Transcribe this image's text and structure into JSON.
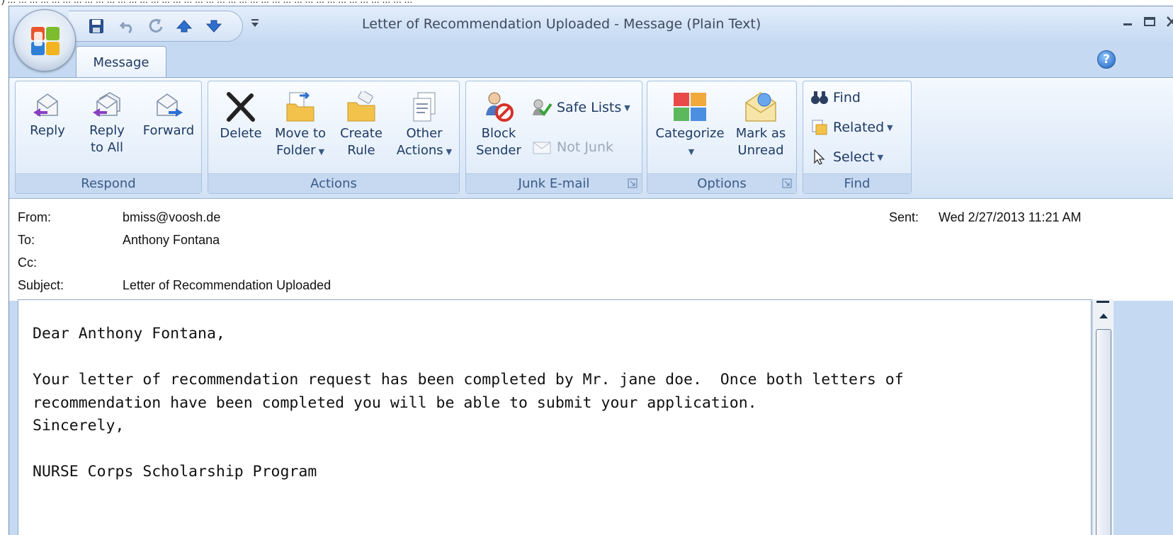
{
  "window": {
    "title": "Letter of Recommendation Uploaded - Message (Plain Text)",
    "top_strip_text": ") ... ... ... ... ... ... ... ... ... ... ... ... ... ... ... ... ... ... ... ... ... ... ... ... ... ... ... ... ... ... ... ... ... ... ... ... ..."
  },
  "tabs": {
    "active": "Message",
    "help": "?"
  },
  "ribbon": {
    "respond": {
      "label": "Respond",
      "reply": "Reply",
      "reply_all_1": "Reply",
      "reply_all_2": "to All",
      "forward": "Forward"
    },
    "actions": {
      "label": "Actions",
      "delete": "Delete",
      "move_1": "Move to",
      "move_2": "Folder",
      "create_1": "Create",
      "create_2": "Rule",
      "other_1": "Other",
      "other_2": "Actions"
    },
    "junk": {
      "label": "Junk E-mail",
      "block_1": "Block",
      "block_2": "Sender",
      "safe_lists": "Safe Lists",
      "not_junk": "Not Junk"
    },
    "options": {
      "label": "Options",
      "categorize": "Categorize",
      "mark_1": "Mark as",
      "mark_2": "Unread"
    },
    "find": {
      "label": "Find",
      "find": "Find",
      "related": "Related",
      "select": "Select"
    }
  },
  "message": {
    "from_label": "From:",
    "from": "bmiss@voosh.de",
    "to_label": "To:",
    "to": "Anthony Fontana",
    "cc_label": "Cc:",
    "cc": "",
    "subject_label": "Subject:",
    "subject": "Letter of Recommendation Uploaded",
    "sent_label": "Sent:",
    "sent": "Wed 2/27/2013 11:21 AM",
    "body": "Dear Anthony Fontana,\n\nYour letter of recommendation request has been completed by Mr. jane doe.  Once both letters of\nrecommendation have been completed you will be able to submit your application.\nSincerely,\n\nNURSE Corps Scholarship Program"
  },
  "colors": {
    "ribbon_bg": "#dde9f8",
    "group_label_bg": "#c6d9f1",
    "text_blue": "#1e3a64"
  }
}
